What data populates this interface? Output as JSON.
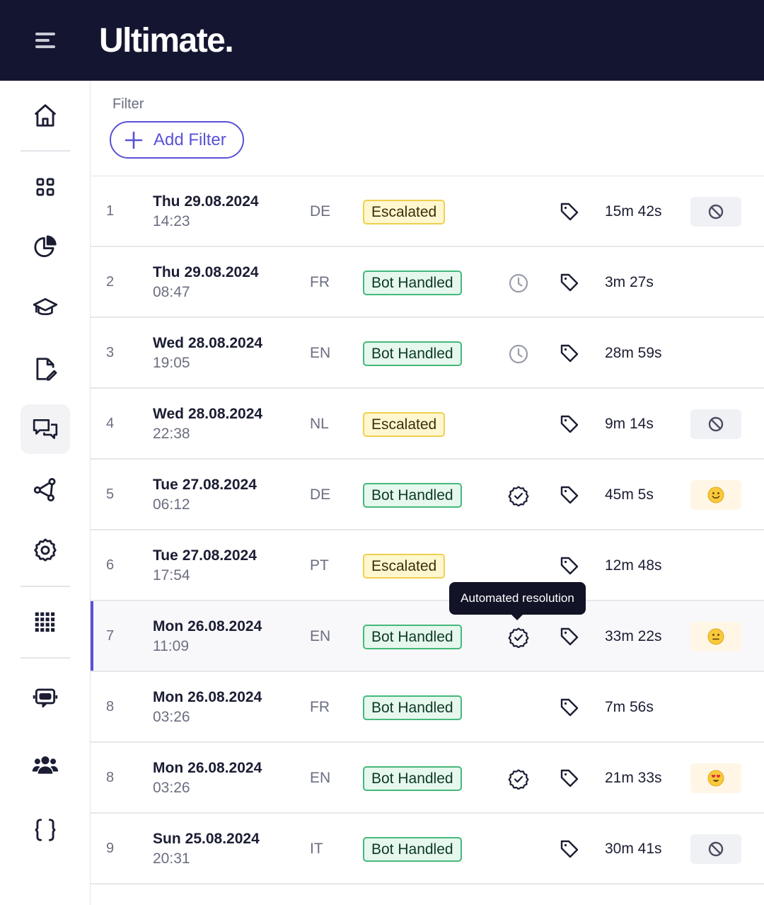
{
  "header": {
    "brand": "Ultimate.",
    "menu_icon": "hamburger-menu-icon"
  },
  "sidebar": {
    "items": [
      {
        "icon": "home-icon",
        "active": false
      },
      {
        "icon": "dashboard-grid-icon",
        "active": false
      },
      {
        "icon": "analytics-pie-icon",
        "active": false
      },
      {
        "icon": "training-cap-icon",
        "active": false
      },
      {
        "icon": "edit-document-icon",
        "active": false
      },
      {
        "icon": "conversations-icon",
        "active": true
      },
      {
        "icon": "integrations-icon",
        "active": false
      },
      {
        "icon": "settings-gear-icon",
        "active": false
      },
      {
        "icon": "apps-grid-icon",
        "active": false
      },
      {
        "icon": "bot-icon",
        "active": false
      },
      {
        "icon": "team-icon",
        "active": false
      },
      {
        "icon": "code-braces-icon",
        "active": false
      }
    ]
  },
  "filter": {
    "label": "Filter",
    "add_button": "Add Filter"
  },
  "rows": [
    {
      "num": "1",
      "day": "Thu",
      "date": "29.08.2024",
      "time": "14:23",
      "lang": "DE",
      "status": "Escalated",
      "resolution": "",
      "duration": "15m 42s",
      "feedback": "no-feedback-icon"
    },
    {
      "num": "2",
      "day": "Thu",
      "date": "29.08.2024",
      "time": "08:47",
      "lang": "FR",
      "status": "Bot Handled",
      "resolution": "clock-icon",
      "duration": "3m 27s",
      "feedback": ""
    },
    {
      "num": "3",
      "day": "Wed",
      "date": "28.08.2024",
      "time": "19:05",
      "lang": "EN",
      "status": "Bot Handled",
      "resolution": "clock-icon",
      "duration": "28m 59s",
      "feedback": ""
    },
    {
      "num": "4",
      "day": "Wed",
      "date": "28.08.2024",
      "time": "22:38",
      "lang": "NL",
      "status": "Escalated",
      "resolution": "",
      "duration": "9m 14s",
      "feedback": "no-feedback-icon"
    },
    {
      "num": "5",
      "day": "Tue",
      "date": "27.08.2024",
      "time": "06:12",
      "lang": "DE",
      "status": "Bot Handled",
      "resolution": "check-badge-icon",
      "duration": "45m 5s",
      "feedback": "smile-emoji-icon"
    },
    {
      "num": "6",
      "day": "Tue",
      "date": "27.08.2024",
      "time": "17:54",
      "lang": "PT",
      "status": "Escalated",
      "resolution": "",
      "duration": "12m 48s",
      "feedback": ""
    },
    {
      "num": "7",
      "day": "Mon",
      "date": "26.08.2024",
      "time": "11:09",
      "lang": "EN",
      "status": "Bot Handled",
      "resolution": "check-badge-icon",
      "duration": "33m 22s",
      "feedback": "neutral-emoji-icon",
      "selected": true
    },
    {
      "num": "8",
      "day": "Mon",
      "date": "26.08.2024",
      "time": "03:26",
      "lang": "FR",
      "status": "Bot Handled",
      "resolution": "",
      "duration": "7m 56s",
      "feedback": ""
    },
    {
      "num": "8",
      "day": "Mon",
      "date": "26.08.2024",
      "time": "03:26",
      "lang": "EN",
      "status": "Bot Handled",
      "resolution": "check-badge-icon",
      "duration": "21m 33s",
      "feedback": "heart-eyes-emoji-icon"
    },
    {
      "num": "9",
      "day": "Sun",
      "date": "25.08.2024",
      "time": "20:31",
      "lang": "IT",
      "status": "Bot Handled",
      "resolution": "",
      "duration": "30m 41s",
      "feedback": "no-feedback-icon"
    }
  ],
  "tooltip": {
    "text": "Automated resolution"
  },
  "colors": {
    "header_bg": "#141631",
    "accent": "#5752d6",
    "escalated_bg": "#fff7cf",
    "escalated_border": "#f1cf4e",
    "bot_bg": "#e6f7ee",
    "bot_border": "#45b97a"
  }
}
